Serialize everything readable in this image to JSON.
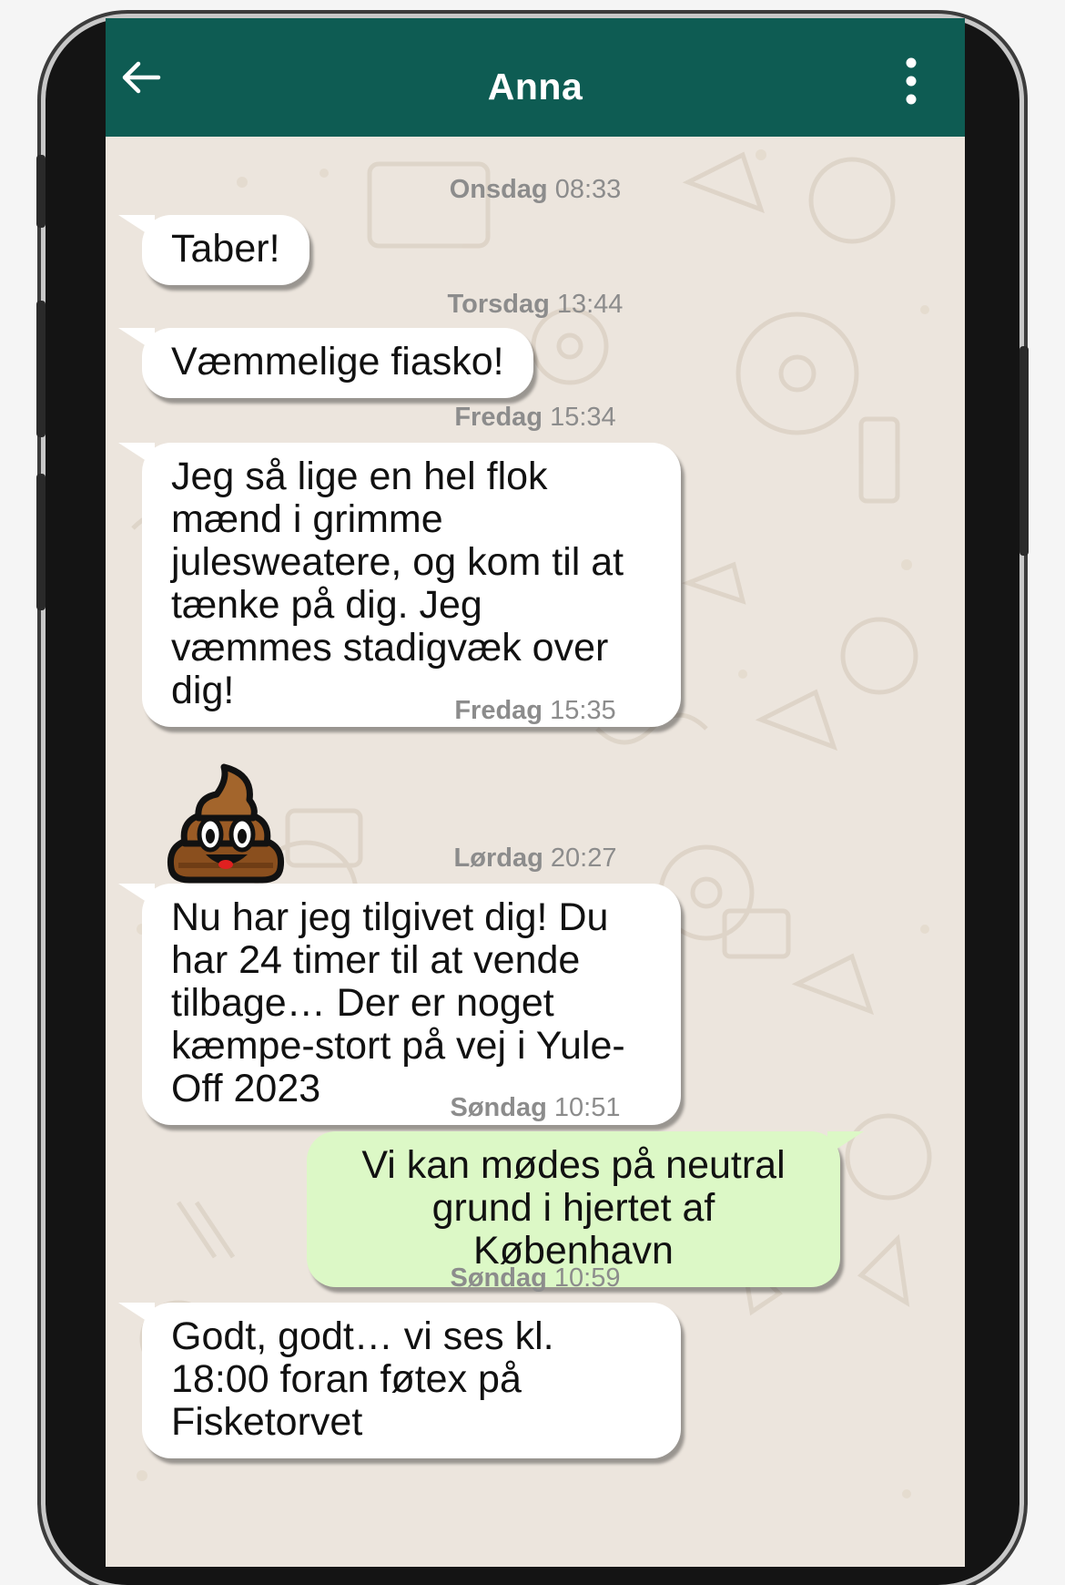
{
  "chat": {
    "contact_name": "Anna",
    "header_color": "#0e5c53",
    "background_color": "#ece5dd",
    "outgoing_color": "#dcf8c6"
  },
  "messages": [
    {
      "day": "Onsdag",
      "time": "08:33",
      "direction": "incoming",
      "text": "Taber!"
    },
    {
      "day": "Torsdag",
      "time": "13:44",
      "direction": "incoming",
      "text": "Væmmelige fiasko!"
    },
    {
      "day": "Fredag",
      "time": "15:34",
      "direction": "incoming",
      "text": "Jeg så lige en hel flok mænd i grimme julesweatere, og kom til at tænke på dig. Jeg væmmes stadigvæk over dig!"
    },
    {
      "day": "Fredag",
      "time": "15:35",
      "direction": "incoming",
      "emoji": "pile-of-poo-icon"
    },
    {
      "day": "Lørdag",
      "time": "20:27",
      "direction": "incoming",
      "text": "Nu har jeg tilgivet dig! Du har 24 timer til at vende tilbage… Der er noget kæmpe-stort på vej i Yule-Off 2023"
    },
    {
      "day": "Søndag",
      "time": "10:51",
      "direction": "outgoing",
      "text": "Vi kan mødes på neutral grund i hjertet af København"
    },
    {
      "day": "Søndag",
      "time": "10:59",
      "direction": "incoming",
      "text": "Godt, godt… vi ses kl. 18:00 foran føtex på Fisketorvet"
    }
  ]
}
